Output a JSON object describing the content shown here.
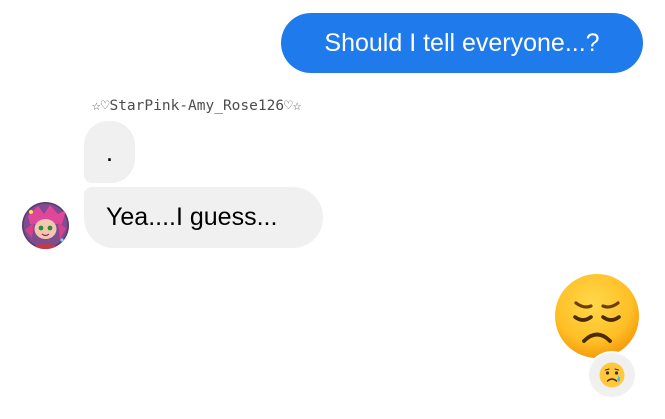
{
  "chat": {
    "outgoing_message": "Should I tell everyone...?",
    "sender_name": "☆♡StarPink-Amy_Rose126♡☆",
    "incoming_messages": [
      ".",
      "Yea....I guess..."
    ],
    "big_emoji": "disappointed-face",
    "reaction_emoji": "crying-face"
  },
  "colors": {
    "outgoing_bubble": "#1f7aeb",
    "incoming_bubble": "#f0f0f0",
    "sender_name_text": "#4d4d4d"
  }
}
